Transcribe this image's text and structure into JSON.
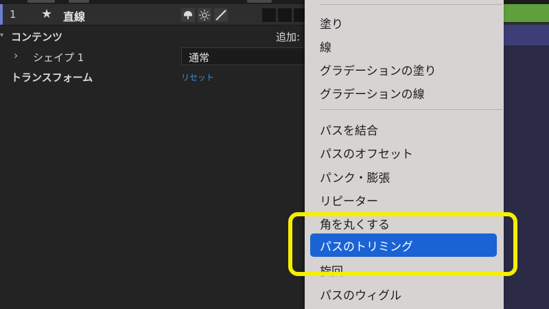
{
  "layer": {
    "index": "1",
    "star_glyph": "★",
    "name": "直線",
    "label_color": "#6a7fd0"
  },
  "switches": {
    "shy_icon": "shy-icon",
    "sun_icon": "collapse-icon",
    "slash_icon": "quality-icon"
  },
  "contents": {
    "label": "コンテンツ",
    "add_label": "追加:"
  },
  "shape": {
    "label": "シェイプ 1",
    "blend_mode": "通常"
  },
  "transform": {
    "label": "トランスフォーム",
    "reset_label": "リセット"
  },
  "menu": {
    "group1": [
      "塗り",
      "線",
      "グラデーションの塗り",
      "グラデーションの線"
    ],
    "group2": [
      "パスを結合",
      "パスのオフセット",
      "パンク・膨張",
      "リピーター",
      "角を丸くする"
    ],
    "selected": "パスのトリミング",
    "group3": [
      "旋回",
      "パスのウィグル"
    ]
  },
  "colors": {
    "highlight": "#f5ef00",
    "selection": "#1a63d5",
    "menu_bg": "#d6d3d2",
    "track_green": "#5fa03c",
    "link_blue": "#3c8de0"
  }
}
